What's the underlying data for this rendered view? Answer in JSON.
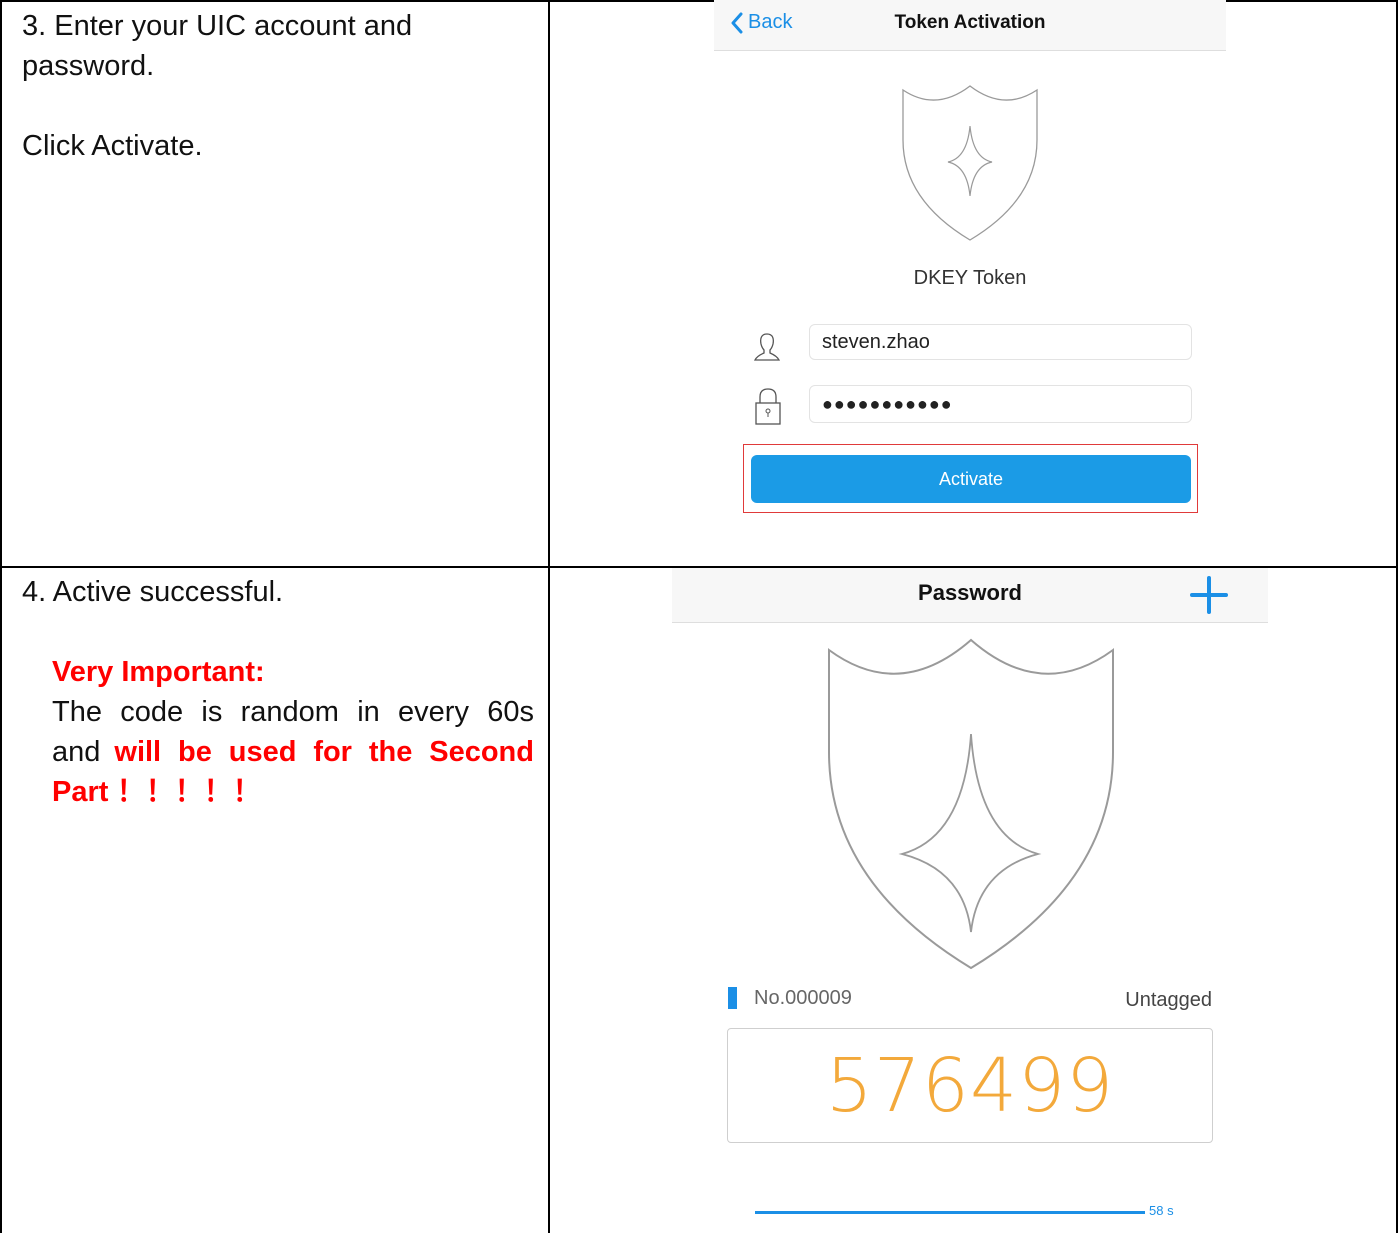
{
  "row1": {
    "step_text": "3. Enter your UIC account and password.",
    "click_text": "Click Activate.",
    "screen": {
      "back_label": "Back",
      "title": "Token Activation",
      "app_name": "DKEY Token",
      "account_value": "steven.zhao",
      "password_value": "●●●●●●●●●●●",
      "activate_label": "Activate"
    }
  },
  "row2": {
    "step_text": "4. Active successful.",
    "important_heading": "Very Important:",
    "body_plain_1": "The code is random in every 60s",
    "body_plain_2": "and",
    "body_red_1": "will be used for the Second",
    "body_red_2": "Part ！！！！！",
    "screen": {
      "title": "Password",
      "token_number": "No.000009",
      "tag": "Untagged",
      "code": "576499",
      "timer": "58 s",
      "timer_progress": 0.967
    }
  },
  "colors": {
    "accent": "#1b9be6",
    "code": "#f3a93b",
    "important": "#ff0000",
    "highlight_border": "#e03a3a"
  },
  "icons": [
    "chevron-left-icon",
    "shield-icon",
    "user-icon",
    "lock-icon",
    "plus-icon",
    "tag-marker-icon"
  ]
}
